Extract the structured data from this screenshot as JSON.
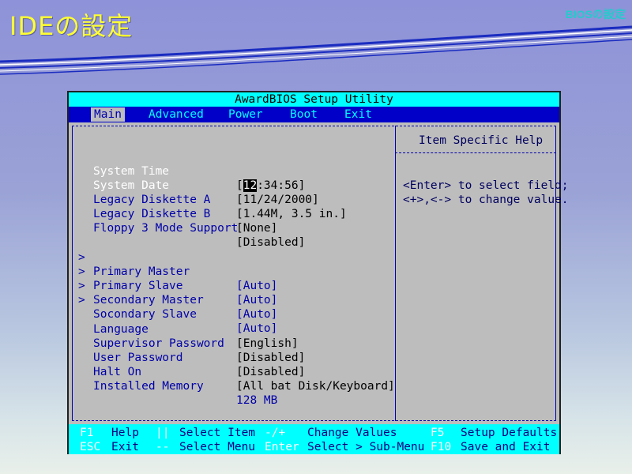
{
  "slide": {
    "title": "IDEの設定",
    "tag": "BIOSの設定"
  },
  "bios": {
    "title": "AwardBIOS Setup Utility",
    "menu": [
      "Main",
      "Advanced",
      "Power",
      "Boot",
      "Exit"
    ],
    "active_menu": "Main",
    "items": [
      {
        "arrow": "",
        "label": "System Time",
        "value_prefix": "[",
        "value_cursor": "12",
        "value_rest": ":34:56]"
      },
      {
        "arrow": "",
        "label": "System Date",
        "value": "[11/24/2000]"
      },
      {
        "arrow": "",
        "label": "Legacy Diskette A",
        "value": "[1.44M, 3.5 in.]"
      },
      {
        "arrow": "",
        "label": "Legacy Diskette B",
        "value": "[None]"
      },
      {
        "arrow": "",
        "label": "Floppy 3 Mode Support",
        "value": "[Disabled]"
      },
      {
        "arrow": ">",
        "label": "Primary Master",
        "value": "[Auto]"
      },
      {
        "arrow": ">",
        "label": "Primary Slave",
        "value": "[Auto]"
      },
      {
        "arrow": ">",
        "label": "Secondary Master",
        "value": "[Auto]"
      },
      {
        "arrow": ">",
        "label": "Socondary Slave",
        "value": "[Auto]"
      },
      {
        "arrow": "",
        "label": "Language",
        "value": "[English]"
      },
      {
        "arrow": "",
        "label": "Supervisor Password",
        "value": "[Disabled]"
      },
      {
        "arrow": "",
        "label": "User Password",
        "value": "[Disabled]"
      },
      {
        "arrow": "",
        "label": "Halt On",
        "value": "[All bat Disk/Keyboard]"
      },
      {
        "arrow": "",
        "label": "Installed Memory",
        "value": "128 MB"
      }
    ],
    "help": {
      "title": "Item Specific Help",
      "lines": [
        "<Enter> to select field;",
        "<+>,<-> to change value."
      ]
    },
    "footer": {
      "row1": [
        {
          "key": "F1",
          "action": "Help"
        },
        {
          "key": "||",
          "action": "Select Item"
        },
        {
          "key": "-/+",
          "action": "Change Values"
        },
        {
          "key": "F5",
          "action": "Setup Defaults"
        }
      ],
      "row2": [
        {
          "key": "ESC",
          "action": "Exit"
        },
        {
          "key": "--",
          "action": "Select Menu"
        },
        {
          "key": "Enter",
          "action": "Select > Sub-Menu"
        },
        {
          "key": "F10",
          "action": "Save and Exit"
        }
      ]
    }
  },
  "colors": {
    "bios_blue": "#000080",
    "cyan": "#00ffff",
    "panel_gray": "#bdbdbd",
    "title_yellow": "#ffff33"
  }
}
